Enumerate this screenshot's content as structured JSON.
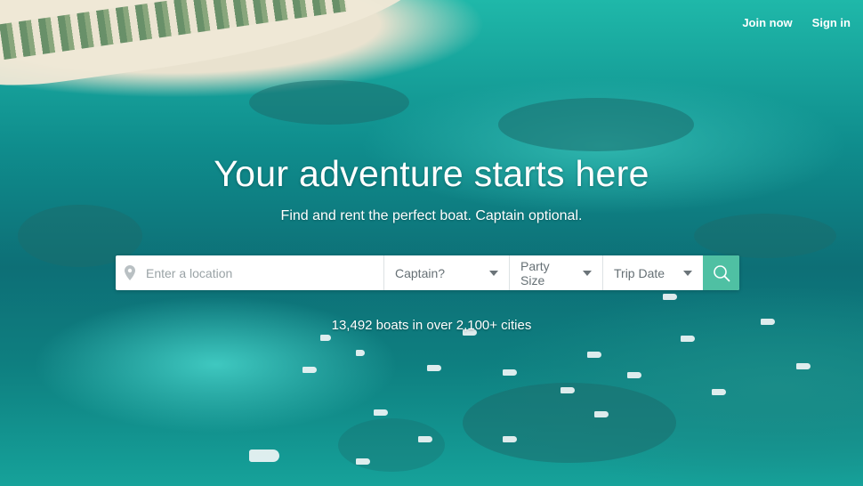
{
  "nav": {
    "join_label": "Join now",
    "signin_label": "Sign in"
  },
  "hero": {
    "headline": "Your adventure starts here",
    "subheadline": "Find and rent the perfect boat. Captain optional.",
    "stats": "13,492 boats in over 2,100+ cities"
  },
  "search": {
    "location_placeholder": "Enter a location",
    "location_icon": "map-pin-icon",
    "captain_label": "Captain?",
    "party_size_label": "Party Size",
    "trip_date_label": "Trip Date",
    "search_icon": "search-icon"
  },
  "colors": {
    "search_button": "#4fc0a3",
    "text_white": "#ffffff"
  }
}
